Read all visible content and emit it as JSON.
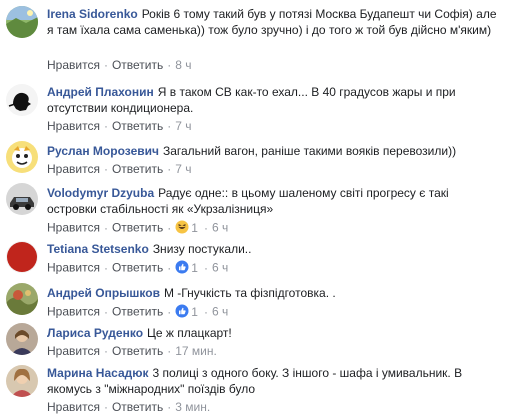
{
  "labels": {
    "like": "Нравится",
    "reply": "Ответить",
    "sep": "·"
  },
  "comments": [
    {
      "author": "Irena Sidorenko",
      "text": "Років 6 тому такий був у потязі Москва Будапешт чи Софія) але я там їхала сама саменька)) тож було зручно) і до того ж той був дійсно м'яким)",
      "time": "8 ч",
      "reactions": null,
      "avatar_color": "#6f8f5a",
      "avatar_icon": "landscape-avatar"
    },
    {
      "author": "Андрей Плахонин",
      "text": "Я в таком СВ как-то ехал... В 40 градусов жары и при отсутствии кондиционера.",
      "time": "7 ч",
      "reactions": null,
      "avatar_color": "#f2f2f2",
      "avatar_icon": "silhouette-avatar"
    },
    {
      "author": "Руслан Морозевич",
      "text": "Загальний вагон, раніше такими вояків перевозили))",
      "time": "7 ч",
      "reactions": null,
      "avatar_color": "#f4d36a",
      "avatar_icon": "cartoon-avatar"
    },
    {
      "author": "Volodymyr Dzyuba",
      "text": "Радує одне:: в цьому шаленому світі прогресу є такі островки стабільності як «Укрзалізниця»",
      "time": "6 ч",
      "reactions": {
        "icon": "haha",
        "count": "1"
      },
      "avatar_color": "#4a4a4a",
      "avatar_icon": "car-avatar"
    },
    {
      "author": "Tetiana Stetsenko",
      "text": "Знизу постукали..",
      "time": "6 ч",
      "reactions": {
        "icon": "like",
        "count": "1"
      },
      "avatar_color": "#c0251c",
      "avatar_icon": "red-circle-avatar"
    },
    {
      "author": "Андрей Опрышков",
      "text": "М -Гнучкість та фізпідготовка. .",
      "time": "6 ч",
      "reactions": {
        "icon": "like",
        "count": "1"
      },
      "avatar_color": "#7a8a4a",
      "avatar_icon": "nature-avatar"
    },
    {
      "author": "Лариса Руденко",
      "text": "Це ж плацкарт!",
      "time": "17 мин.",
      "reactions": null,
      "avatar_color": "#8a7a6a",
      "avatar_icon": "person-avatar"
    },
    {
      "author": "Марина Насадюк",
      "text": "3 полиці з одного боку. З іншого - шафа і умивальник. В якомусь з \"міжнародних\" поїздів було",
      "time": "3 мин.",
      "reactions": null,
      "avatar_color": "#b09070",
      "avatar_icon": "person-avatar"
    }
  ]
}
